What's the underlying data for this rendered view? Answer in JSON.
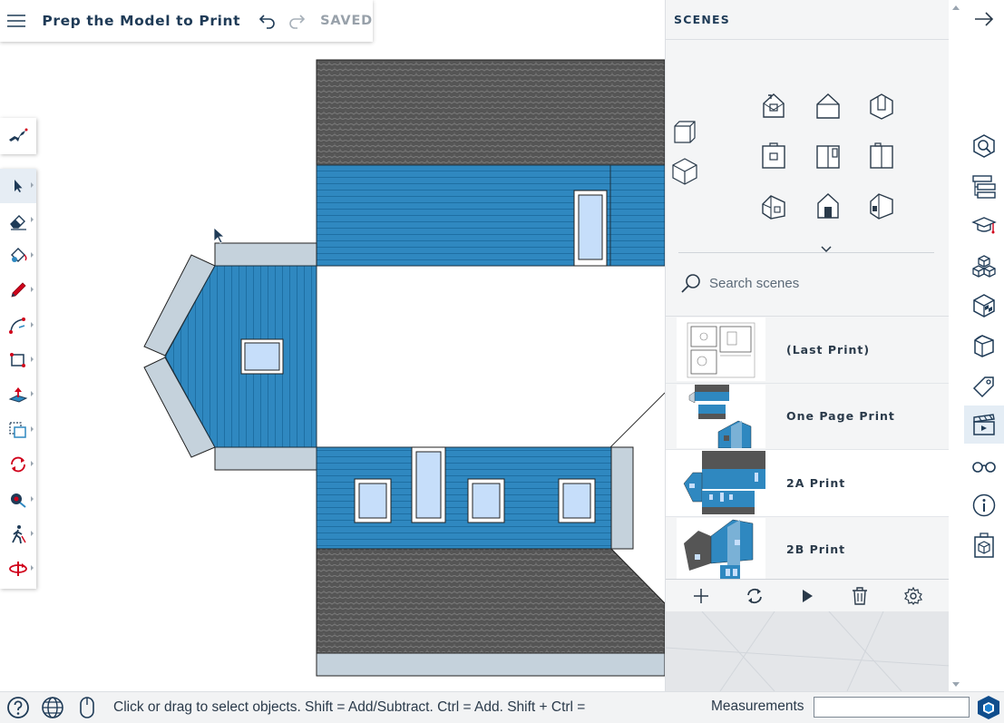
{
  "app": {
    "title": "Prep the Model to Print",
    "save_state": "SAVED"
  },
  "icons": {
    "menu": "hamburger-icon",
    "undo": "undo-icon",
    "redo": "redo-icon"
  },
  "left_toolbar": {
    "solo": "instructor-icon",
    "tools": [
      {
        "name": "select",
        "active": true
      },
      {
        "name": "eraser"
      },
      {
        "name": "paint-bucket"
      },
      {
        "name": "pencil"
      },
      {
        "name": "arc"
      },
      {
        "name": "rectangle"
      },
      {
        "name": "push-pull"
      },
      {
        "name": "move"
      },
      {
        "name": "rotate"
      },
      {
        "name": "tape-measure"
      },
      {
        "name": "walk"
      },
      {
        "name": "orbit"
      }
    ]
  },
  "scenes_panel": {
    "header": "SCENES",
    "more_views": "chevron-down-icon",
    "search_placeholder": "Search scenes",
    "scenes": [
      {
        "name": "(Last Print)",
        "selected": false
      },
      {
        "name": "One Page Print",
        "selected": false
      },
      {
        "name": "2A Print",
        "selected": true
      },
      {
        "name": "2B Print",
        "selected": false
      }
    ],
    "footer": [
      "add-icon",
      "refresh-icon",
      "play-icon",
      "delete-icon",
      "settings-icon"
    ]
  },
  "right_rail": {
    "collapse": "arrow-right-icon",
    "panels": [
      "entity-info",
      "outliner",
      "instructor",
      "components",
      "materials",
      "styles",
      "tags",
      "scenes",
      "display",
      "model-info",
      "solid-inspector"
    ],
    "active": "scenes"
  },
  "status_bar": {
    "message": "Click or drag to select objects. Shift = Add/Subtract. Ctrl = Add. Shift + Ctrl =",
    "measurements_label": "Measurements",
    "measurements_value": ""
  },
  "colors": {
    "accent": "#1f3b57",
    "siding": "#2f88c0",
    "trim": "#c5d2dc",
    "roof": "#545454",
    "glass": "#c6defa",
    "active_bg": "#e4edf5"
  }
}
